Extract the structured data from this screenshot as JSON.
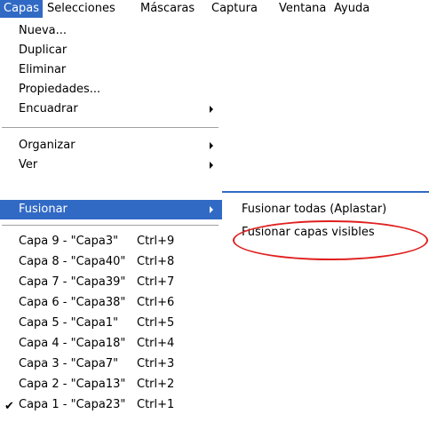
{
  "menubar": {
    "items": [
      "Capas",
      "Selecciones",
      "Máscaras",
      "Captura",
      "Ventana",
      "Ayuda"
    ],
    "active_index": 0
  },
  "menu": {
    "nueva": "Nueva...",
    "duplicar": "Duplicar",
    "eliminar": "Eliminar",
    "propiedades": "Propiedades...",
    "encuadrar": "Encuadrar",
    "organizar": "Organizar",
    "ver": "Ver",
    "fusionar": "Fusionar",
    "layers": [
      {
        "name": "Capa 9 - \"Capa3\"",
        "shortcut": "Ctrl+9",
        "checked": false
      },
      {
        "name": "Capa 8 - \"Capa40\"",
        "shortcut": "Ctrl+8",
        "checked": false
      },
      {
        "name": "Capa 7 - \"Capa39\"",
        "shortcut": "Ctrl+7",
        "checked": false
      },
      {
        "name": "Capa 6 - \"Capa38\"",
        "shortcut": "Ctrl+6",
        "checked": false
      },
      {
        "name": "Capa 5 - \"Capa1\"",
        "shortcut": "Ctrl+5",
        "checked": false
      },
      {
        "name": "Capa 4 - \"Capa18\"",
        "shortcut": "Ctrl+4",
        "checked": false
      },
      {
        "name": "Capa 3 - \"Capa7\"",
        "shortcut": "Ctrl+3",
        "checked": false
      },
      {
        "name": "Capa 2 - \"Capa13\"",
        "shortcut": "Ctrl+2",
        "checked": false
      },
      {
        "name": "Capa 1 - \"Capa23\"",
        "shortcut": "Ctrl+1",
        "checked": true
      }
    ],
    "check_glyph": "✔"
  },
  "submenu": {
    "fusionar_todas": "Fusionar todas (Aplastar)",
    "fusionar_visibles": "Fusionar capas visibles"
  },
  "colors": {
    "highlight": "#316ac5",
    "annotation": "#e02020"
  }
}
